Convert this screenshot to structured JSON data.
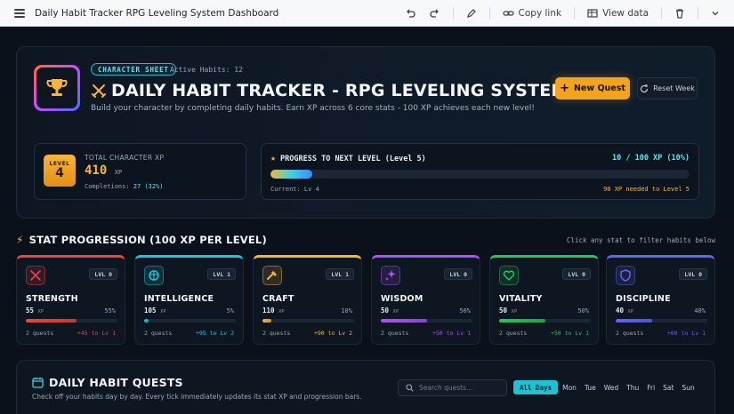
{
  "appbar": {
    "title": "Daily Habit Tracker RPG Leveling System Dashboard",
    "copy_link": "Copy link",
    "view_data": "View data"
  },
  "hero": {
    "badge": "CHARACTER SHEET",
    "active_habits": "Active Habits: 12",
    "title": "DAILY HABIT TRACKER - RPG LEVELING SYSTEM",
    "subtitle": "Build your character by completing daily habits. Earn XP across 6 core stats - 100 XP achieves each new level!",
    "new_quest": "New Quest",
    "reset_week": "Reset Week"
  },
  "character": {
    "level_label": "LEVEL",
    "level": "4",
    "total_label": "TOTAL CHARACTER XP",
    "total_xp": "410",
    "xp_unit": "XP",
    "completions_label": "Completions:",
    "completions": "27 (32%)"
  },
  "progress": {
    "title": "PROGRESS TO NEXT LEVEL (Level 5)",
    "value_text": "10 / 100 XP (10%)",
    "fraction": 0.1,
    "current": "Current: Lv 4",
    "needed": "90 XP needed to Level 5"
  },
  "stats_section": {
    "title": "STAT PROGRESSION (100 XP PER LEVEL)",
    "hint": "Click any stat to filter habits below"
  },
  "stats": [
    {
      "name": "STRENGTH",
      "level": "LVL 0",
      "xp": "55",
      "unit": "XP",
      "pct": "55%",
      "fraction": 0.55,
      "quests": "2 quests",
      "next": "+45 to Lv 1",
      "color": "#ef4444",
      "icon": "sword-icon"
    },
    {
      "name": "INTELLIGENCE",
      "level": "LVL 1",
      "xp": "105",
      "unit": "XP",
      "pct": "5%",
      "fraction": 0.05,
      "quests": "2 quests",
      "next": "+95 to Lv 2",
      "color": "#22c3d6",
      "icon": "brain-icon"
    },
    {
      "name": "CRAFT",
      "level": "LVL 1",
      "xp": "110",
      "unit": "XP",
      "pct": "10%",
      "fraction": 0.1,
      "quests": "2 quests",
      "next": "+90 to Lv 2",
      "color": "#f6b63b",
      "icon": "hammer-icon"
    },
    {
      "name": "WISDOM",
      "level": "LVL 0",
      "xp": "50",
      "unit": "XP",
      "pct": "50%",
      "fraction": 0.5,
      "quests": "2 quests",
      "next": "+50 to Lv 1",
      "color": "#a855f7",
      "icon": "sparkle-icon"
    },
    {
      "name": "VITALITY",
      "level": "LVL 0",
      "xp": "50",
      "unit": "XP",
      "pct": "50%",
      "fraction": 0.5,
      "quests": "2 quests",
      "next": "+50 to Lv 1",
      "color": "#22c55e",
      "icon": "heart-icon"
    },
    {
      "name": "DISCIPLINE",
      "level": "LVL 0",
      "xp": "40",
      "unit": "XP",
      "pct": "40%",
      "fraction": 0.4,
      "quests": "2 quests",
      "next": "+60 to Lv 1",
      "color": "#6366f1",
      "icon": "shield-icon"
    }
  ],
  "quests": {
    "title": "DAILY HABIT QUESTS",
    "subtitle": "Check off your habits day by day. Every tick immediately updates its stat XP and progression bars.",
    "search_placeholder": "Search quests...",
    "days": [
      "All Days",
      "Mon",
      "Tue",
      "Wed",
      "Thu",
      "Fri",
      "Sat",
      "Sun"
    ]
  }
}
